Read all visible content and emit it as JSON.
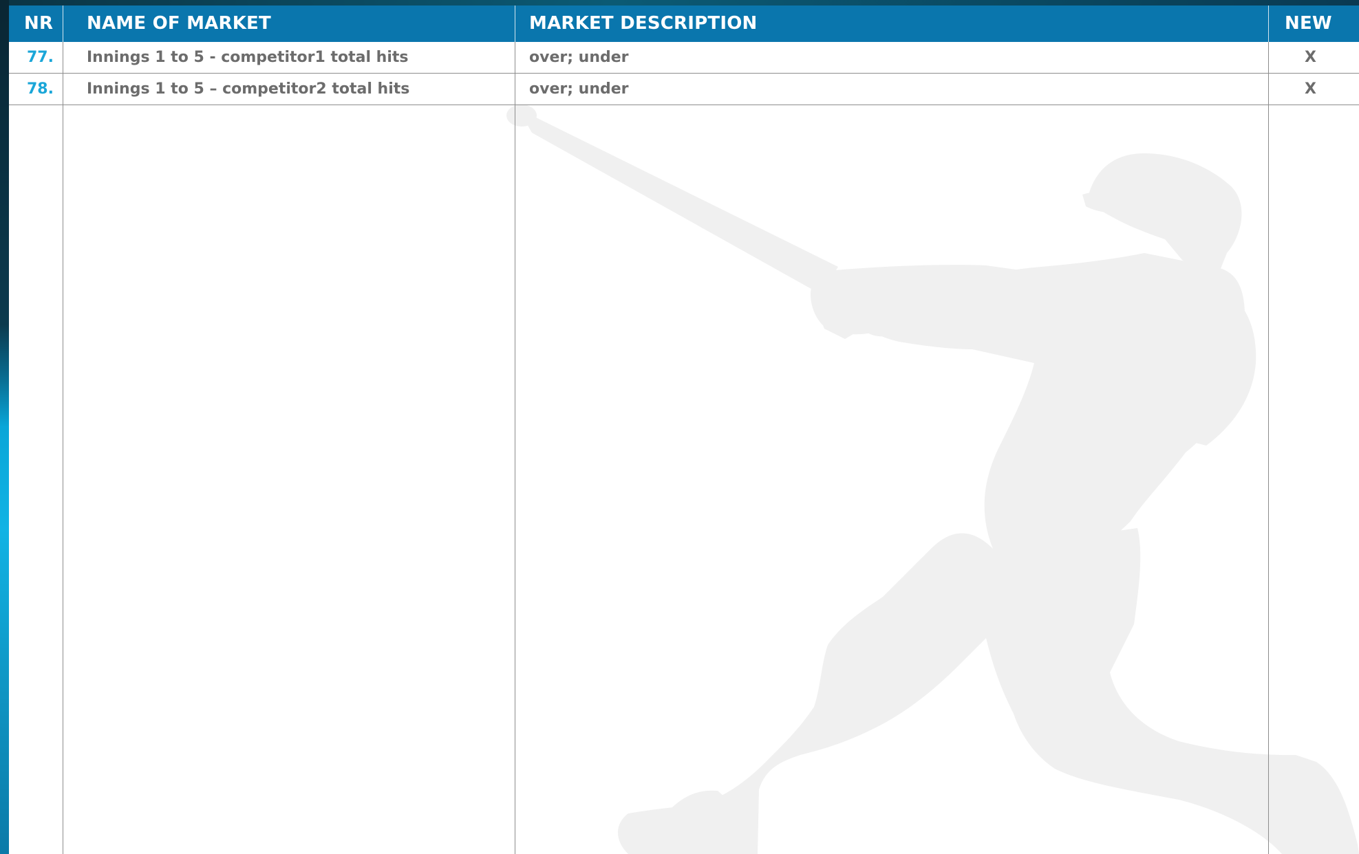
{
  "table": {
    "columns": {
      "nr": "NR",
      "name": "NAME OF MARKET",
      "description": "MARKET DESCRIPTION",
      "new": "NEW"
    },
    "rows": [
      {
        "nr": "77.",
        "name": "Innings 1 to 5 - competitor1 total hits",
        "description": "over; under",
        "new": "X"
      },
      {
        "nr": "78.",
        "name": "Innings 1 to 5 – competitor2 total hits",
        "description": "over; under",
        "new": "X"
      }
    ]
  },
  "colors": {
    "header_bg": "#0a76ad",
    "header_text": "#ffffff",
    "row_number": "#1aa6d8",
    "row_text": "#6c6c6c",
    "watermark": "#f0f0f0"
  },
  "icons": {
    "watermark": "baseball-batter-silhouette-icon"
  }
}
